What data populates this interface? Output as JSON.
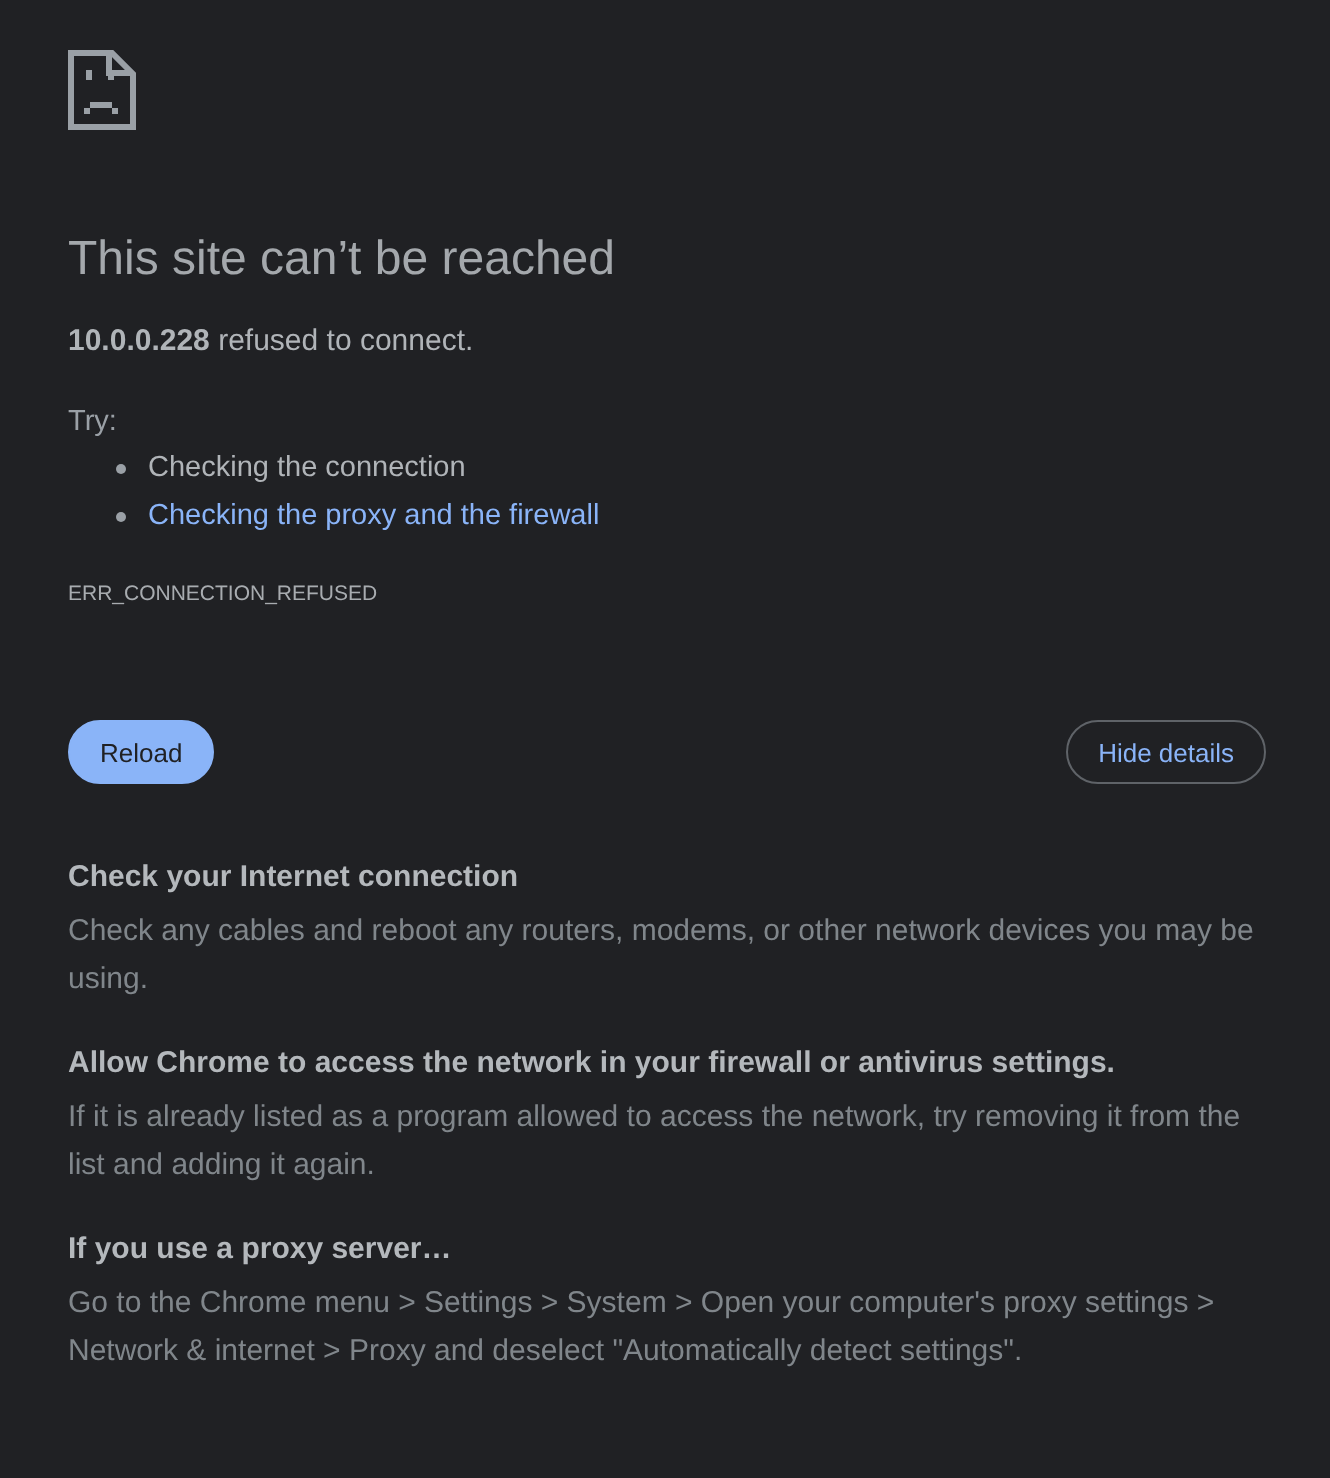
{
  "heading": "This site can’t be reached",
  "message": "**10.0.0.228** refused to connect.",
  "suggestions": {
    "label": "Try:",
    "items": [
      {
        "kind": "text",
        "text": "Checking the connection"
      },
      {
        "kind": "link",
        "text": "Checking the proxy and the firewall"
      }
    ]
  },
  "error_code": "ERR_CONNECTION_REFUSED",
  "buttons": [
    {
      "kind": "primary",
      "label": "Reload"
    },
    {
      "kind": "outline",
      "label": "Hide details"
    }
  ],
  "details": [
    {
      "title": "Check your Internet connection",
      "text": "Check any cables and reboot any routers, modems, or other network devices you may be using."
    },
    {
      "title": "Allow Chrome to access the network in your firewall or antivirus settings.",
      "text": "If it is already listed as a program allowed to access the network, try removing it from the list and adding it again."
    },
    {
      "title": "If you use a proxy server…",
      "text": "Go to the Chrome menu > Settings > System > Open your computer's proxy settings > Network & internet > Proxy and deselect \"Automatically detect settings\"."
    }
  ]
}
